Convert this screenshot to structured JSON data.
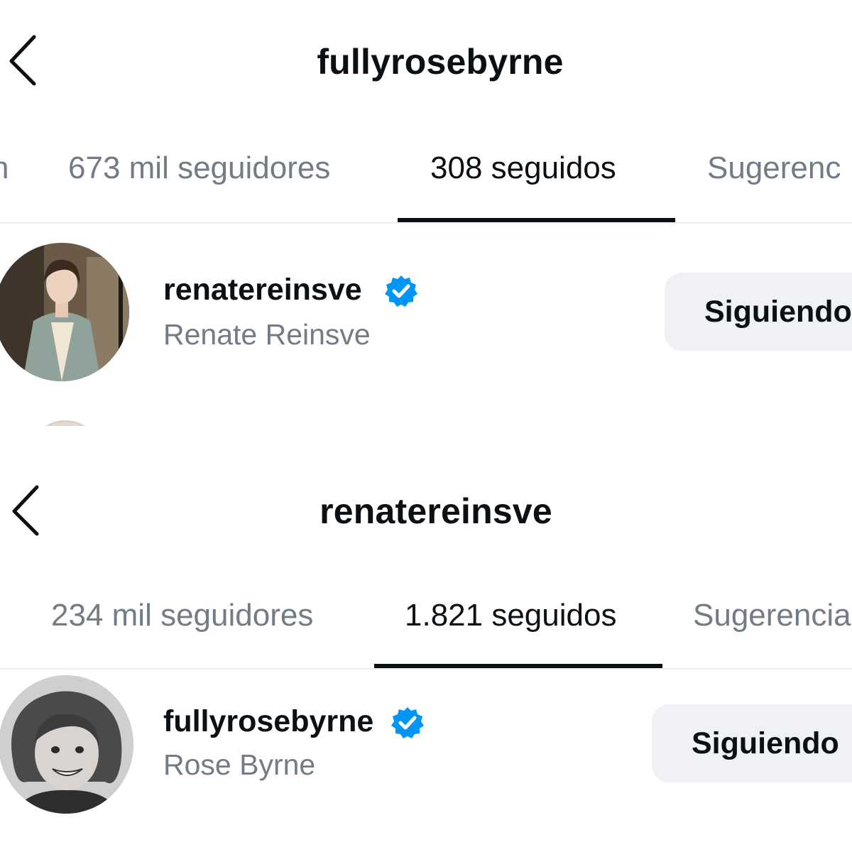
{
  "panels": [
    {
      "header": {
        "title": "fullyrosebyrne"
      },
      "tabs": [
        {
          "label": "n"
        },
        {
          "label": "673 mil seguidores"
        },
        {
          "label": "308 seguidos"
        },
        {
          "label": "Sugerenc"
        }
      ],
      "active_tab": "308 seguidos",
      "list_item": {
        "username": "renatereinsve",
        "full_name": "Renate Reinsve",
        "verified": true,
        "button_label": "Siguiendo"
      }
    },
    {
      "header": {
        "title": "renatereinsve"
      },
      "tabs": [
        {
          "label": "234 mil seguidores"
        },
        {
          "label": "1.821 seguidos"
        },
        {
          "label": "Sugerencia"
        }
      ],
      "active_tab": "1.821 seguidos",
      "list_item": {
        "username": "fullyrosebyrne",
        "full_name": "Rose Byrne",
        "verified": true,
        "button_label": "Siguiendo"
      }
    }
  ],
  "colors": {
    "text_primary": "#0b1014",
    "text_secondary": "#737b86",
    "verified_blue": "#0095f6",
    "button_bg": "#eff1f4",
    "divider": "#eeeff1"
  },
  "icons": {
    "back": "chevron-left-icon",
    "verified": "verified-badge-icon"
  }
}
